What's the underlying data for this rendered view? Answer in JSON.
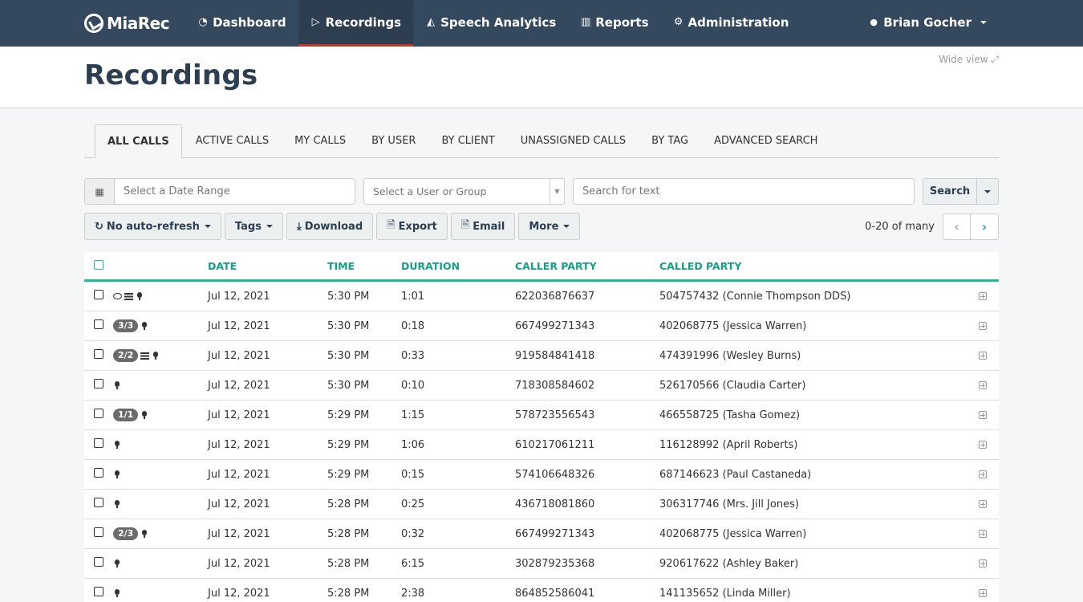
{
  "navbar": {
    "brand": "MiaRec",
    "items": [
      {
        "label": "Dashboard",
        "icon": "dashboard-icon",
        "glyph": "◔",
        "active": false
      },
      {
        "label": "Recordings",
        "icon": "play-square-icon",
        "glyph": "▷",
        "active": true
      },
      {
        "label": "Speech Analytics",
        "icon": "area-chart-icon",
        "glyph": "◭",
        "active": false
      },
      {
        "label": "Reports",
        "icon": "bar-chart-icon",
        "glyph": "▥",
        "active": false
      },
      {
        "label": "Administration",
        "icon": "gear-icon",
        "glyph": "⚙",
        "active": false
      }
    ],
    "user": {
      "name": "Brian Gocher",
      "icon": "user-icon",
      "glyph": "👤"
    },
    "accent_color": "#c0392b",
    "bg_color": "#34495e"
  },
  "header": {
    "title": "Recordings",
    "wide_view": "Wide view ⤢"
  },
  "tabs": [
    {
      "label": "ALL CALLS",
      "active": true
    },
    {
      "label": "ACTIVE CALLS",
      "active": false
    },
    {
      "label": "MY CALLS",
      "active": false
    },
    {
      "label": "BY USER",
      "active": false
    },
    {
      "label": "BY CLIENT",
      "active": false
    },
    {
      "label": "UNASSIGNED CALLS",
      "active": false
    },
    {
      "label": "BY TAG",
      "active": false
    },
    {
      "label": "ADVANCED SEARCH",
      "active": false
    }
  ],
  "filters": {
    "date_placeholder": "Select a Date Range",
    "date_value": "",
    "user_placeholder": "Select a User or Group",
    "user_value": "",
    "search_placeholder": "Search for text",
    "search_value": "",
    "search_label": "Search"
  },
  "toolbar": {
    "refresh_label": "No auto-refresh",
    "tags_label": "Tags",
    "download_label": "Download",
    "export_label": "Export",
    "email_label": "Email",
    "more_label": "More",
    "pager_info": "0-20 of many"
  },
  "table": {
    "header_color": "#16a085",
    "columns": [
      "DATE",
      "TIME",
      "DURATION",
      "CALLER PARTY",
      "CALLED PARTY"
    ],
    "rows": [
      {
        "badge": "",
        "icons": [
          "comment",
          "list",
          "mic"
        ],
        "date": "Jul 12, 2021",
        "time": "5:30 PM",
        "duration": "1:01",
        "caller": "622036876637",
        "called": "504757432 (Connie Thompson DDS)"
      },
      {
        "badge": "3/3",
        "icons": [
          "mic"
        ],
        "date": "Jul 12, 2021",
        "time": "5:30 PM",
        "duration": "0:18",
        "caller": "667499271343",
        "called": "402068775 (Jessica Warren)"
      },
      {
        "badge": "2/2",
        "icons": [
          "list",
          "mic"
        ],
        "date": "Jul 12, 2021",
        "time": "5:30 PM",
        "duration": "0:33",
        "caller": "919584841418",
        "called": "474391996 (Wesley Burns)"
      },
      {
        "badge": "",
        "icons": [
          "mic"
        ],
        "date": "Jul 12, 2021",
        "time": "5:30 PM",
        "duration": "0:10",
        "caller": "718308584602",
        "called": "526170566 (Claudia Carter)"
      },
      {
        "badge": "1/1",
        "icons": [
          "mic"
        ],
        "date": "Jul 12, 2021",
        "time": "5:29 PM",
        "duration": "1:15",
        "caller": "578723556543",
        "called": "466558725 (Tasha Gomez)"
      },
      {
        "badge": "",
        "icons": [
          "mic"
        ],
        "date": "Jul 12, 2021",
        "time": "5:29 PM",
        "duration": "1:06",
        "caller": "610217061211",
        "called": "116128992 (April Roberts)"
      },
      {
        "badge": "",
        "icons": [
          "mic"
        ],
        "date": "Jul 12, 2021",
        "time": "5:29 PM",
        "duration": "0:15",
        "caller": "574106648326",
        "called": "687146623 (Paul Castaneda)"
      },
      {
        "badge": "",
        "icons": [
          "mic"
        ],
        "date": "Jul 12, 2021",
        "time": "5:28 PM",
        "duration": "0:25",
        "caller": "436718081860",
        "called": "306317746 (Mrs. Jill Jones)"
      },
      {
        "badge": "2/3",
        "icons": [
          "mic"
        ],
        "date": "Jul 12, 2021",
        "time": "5:28 PM",
        "duration": "0:32",
        "caller": "667499271343",
        "called": "402068775 (Jessica Warren)"
      },
      {
        "badge": "",
        "icons": [
          "mic"
        ],
        "date": "Jul 12, 2021",
        "time": "5:28 PM",
        "duration": "6:15",
        "caller": "302879235368",
        "called": "920617622 (Ashley Baker)"
      },
      {
        "badge": "",
        "icons": [
          "mic"
        ],
        "date": "Jul 12, 2021",
        "time": "5:28 PM",
        "duration": "2:38",
        "caller": "864852586041",
        "called": "141135652 (Linda Miller)"
      }
    ]
  }
}
